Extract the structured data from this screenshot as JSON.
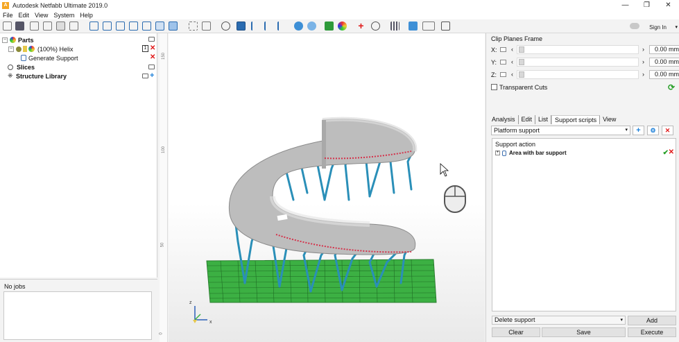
{
  "window": {
    "title": "Autodesk Netfabb Ultimate 2019.0",
    "logo": "A",
    "controls": [
      "—",
      "❐",
      "✕"
    ]
  },
  "menu": [
    "File",
    "Edit",
    "View",
    "System",
    "Help"
  ],
  "account": {
    "sign_in": "Sign In"
  },
  "tree": {
    "parts": "Parts",
    "helix": "(100%) Helix",
    "helix_badge": "1",
    "generate_support": "Generate Support",
    "slices": "Slices",
    "structure_library": "Structure Library"
  },
  "jobs": {
    "label": "No jobs"
  },
  "ruler": {
    "labels": [
      "150",
      "100",
      "50",
      "0"
    ]
  },
  "axes": {
    "z": "z",
    "x": "x"
  },
  "clip": {
    "title": "Clip Planes Frame",
    "rows": [
      {
        "axis": "X:",
        "value": "0.00 mm"
      },
      {
        "axis": "Y:",
        "value": "0.00 mm"
      },
      {
        "axis": "Z:",
        "value": "0.00 mm"
      }
    ],
    "transparent_cuts": "Transparent Cuts"
  },
  "tabs": [
    "Analysis",
    "Edit",
    "List",
    "Support scripts",
    "View"
  ],
  "active_tab": "Support scripts",
  "support": {
    "platform": "Platform support",
    "action_header": "Support action",
    "action_item": "Area with bar support",
    "delete_support": "Delete support",
    "add": "Add",
    "clear": "Clear",
    "save": "Save",
    "execute": "Execute"
  },
  "colors": {
    "support_blue": "#2a8fb8",
    "platform_green": "#3cb043",
    "helix_gray": "#b8b8b8",
    "contact_red": "#d4314a"
  }
}
